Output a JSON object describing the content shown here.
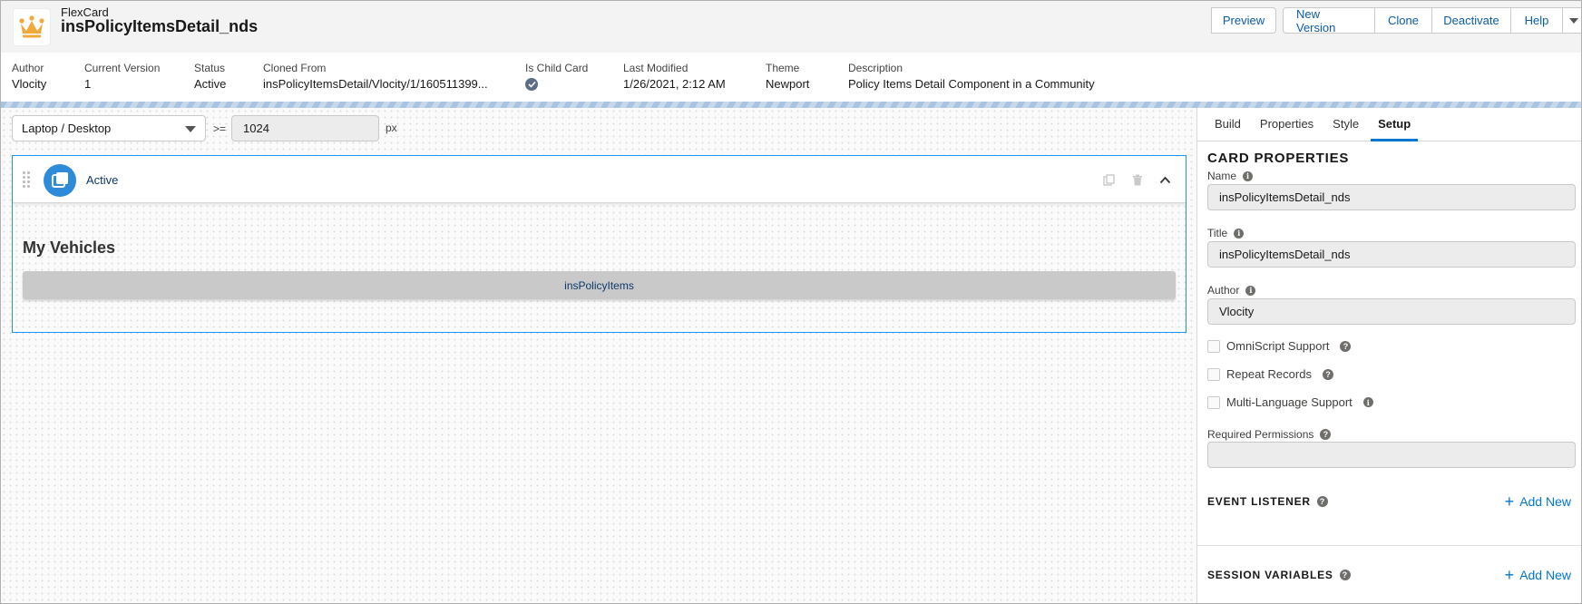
{
  "header": {
    "kicker": "FlexCard",
    "title": "insPolicyItemsDetail_nds",
    "buttons": {
      "preview": "Preview",
      "new_version": "New Version",
      "clone": "Clone",
      "deactivate": "Deactivate",
      "help": "Help"
    }
  },
  "highlights": [
    {
      "label": "Author",
      "value": "Vlocity"
    },
    {
      "label": "Current Version",
      "value": "1"
    },
    {
      "label": "Status",
      "value": "Active"
    },
    {
      "label": "Cloned From",
      "value": "insPolicyItemsDetail/Vlocity/1/160511399..."
    },
    {
      "label": "Is Child Card",
      "value": ""
    },
    {
      "label": "Last Modified",
      "value": "1/26/2021, 2:12 AM"
    },
    {
      "label": "Theme",
      "value": "Newport"
    },
    {
      "label": "Description",
      "value": "Policy Items Detail Component in a Community"
    }
  ],
  "canvas": {
    "device": "Laptop / Desktop",
    "gte": ">=",
    "width_value": "1024",
    "unit": "px",
    "state_label": "Active",
    "heading": "My Vehicles",
    "child_card": "insPolicyItems"
  },
  "panel": {
    "tabs": [
      "Build",
      "Properties",
      "Style",
      "Setup"
    ],
    "active_tab": "Setup",
    "section_title": "CARD PROPERTIES",
    "name_label": "Name",
    "name_value": "insPolicyItemsDetail_nds",
    "title_label": "Title",
    "title_value": "insPolicyItemsDetail_nds",
    "author_label": "Author",
    "author_value": "Vlocity",
    "checkboxes": {
      "omniscript": "OmniScript Support",
      "repeat": "Repeat Records",
      "multilang": "Multi-Language Support"
    },
    "permissions_label": "Required Permissions",
    "permissions_value": "",
    "event_listener": "EVENT LISTENER",
    "session_variables": "SESSION VARIABLES",
    "add_new": "Add New"
  },
  "colors": {
    "brand_blue": "#0176d3",
    "link_blue": "#0b5cab",
    "crown": "#f2a93b"
  }
}
